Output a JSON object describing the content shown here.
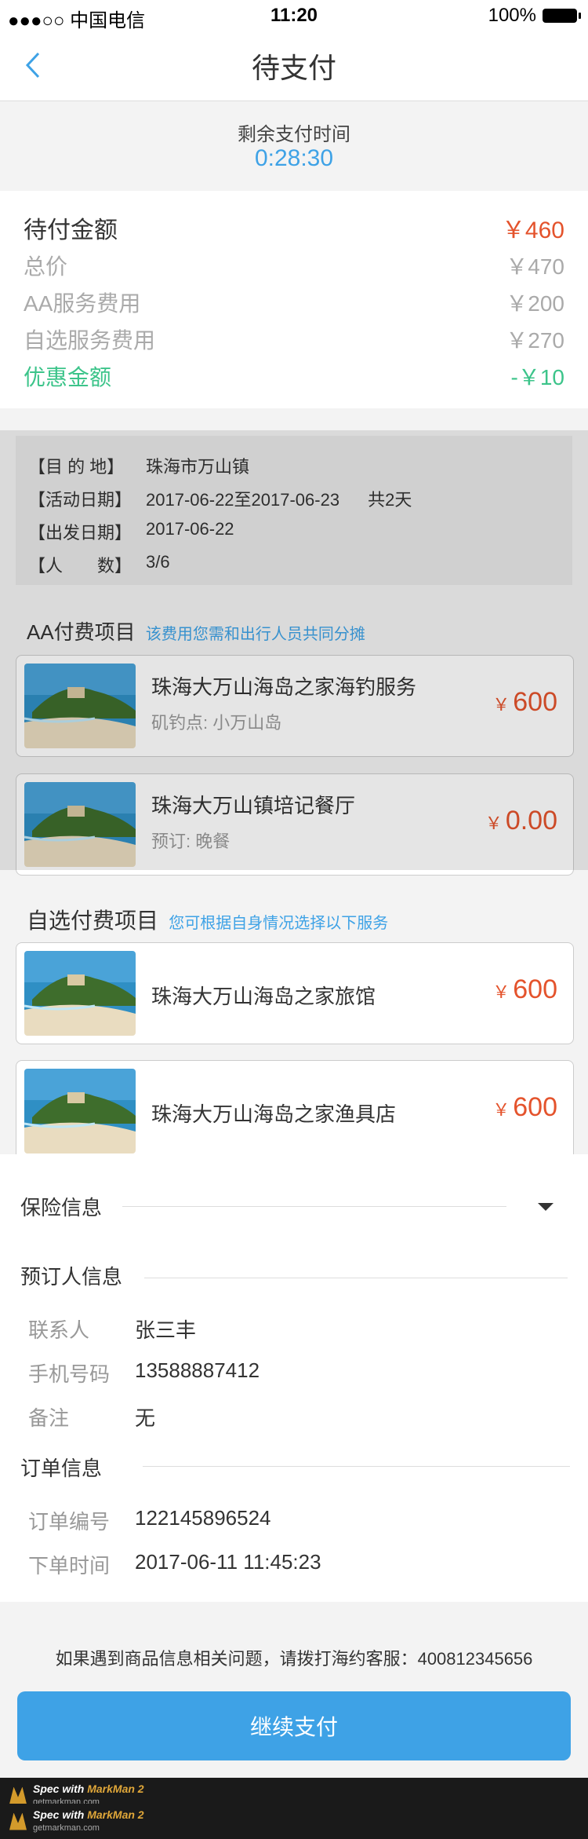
{
  "status_bar": {
    "carrier": "●●●○○ 中国电信",
    "time": "11:20",
    "battery": "100%"
  },
  "navbar": {
    "title": "待支付"
  },
  "countdown": {
    "label": "剩余支付时间",
    "time": "0:28:30"
  },
  "amounts": {
    "due": {
      "label": "待付金额",
      "value": "￥460"
    },
    "total": {
      "label": "总价",
      "value": "￥470"
    },
    "aa_fee": {
      "label": "AA服务费用",
      "value": "￥200"
    },
    "optional_fee": {
      "label": "自选服务费用",
      "value": "￥270"
    },
    "discount": {
      "label": "优惠金额",
      "value": "-￥10"
    }
  },
  "trip": {
    "destination": {
      "label": "【目 的 地】",
      "value": "珠海市万山镇"
    },
    "dates": {
      "label": "【活动日期】",
      "value": "2017-06-22至2017-06-23",
      "days": "共2天"
    },
    "departure": {
      "label": "【出发日期】",
      "value": "2017-06-22"
    },
    "people": {
      "label": "【人　　数】",
      "value": "3/6"
    }
  },
  "aa_section": {
    "title": "AA付费项目",
    "hint": "该费用您需和出行人员共同分摊"
  },
  "aa_items": [
    {
      "name": "珠海大万山海岛之家海钓服务",
      "sub": "矶钓点:  小万山岛",
      "currency": "￥",
      "price": "600"
    },
    {
      "name": "珠海大万山镇培记餐厅",
      "sub": "预订:  晚餐",
      "currency": "￥",
      "price": "0.00"
    }
  ],
  "optional_section": {
    "title": "自选付费项目",
    "hint": "您可根据自身情况选择以下服务"
  },
  "optional_items": [
    {
      "name": "珠海大万山海岛之家旅馆",
      "currency": "￥",
      "price": "600"
    },
    {
      "name": "珠海大万山海岛之家渔具店",
      "currency": "￥",
      "price": "600"
    }
  ],
  "insurance": {
    "title": "保险信息"
  },
  "booker": {
    "title": "预订人信息",
    "contact": {
      "label": "联系人",
      "value": "张三丰"
    },
    "phone": {
      "label": "手机号码",
      "value": "13588887412"
    },
    "note": {
      "label": "备注",
      "value": "无"
    }
  },
  "order": {
    "title": "订单信息",
    "number": {
      "label": "订单编号",
      "value": "122145896524"
    },
    "time": {
      "label": "下单时间",
      "value": "2017-06-11  11:45:23"
    }
  },
  "footer": {
    "note": "如果遇到商品信息相关问题，请拨打海约客服：400812345656",
    "button": "继续支付"
  },
  "watermark": {
    "brand_prefix": "Spec with ",
    "brand": "MarkMan 2",
    "url": "getmarkman.com"
  },
  "colors": {
    "accent": "#3ea2e6",
    "price": "#e4532c",
    "discount": "#3cc48a"
  }
}
